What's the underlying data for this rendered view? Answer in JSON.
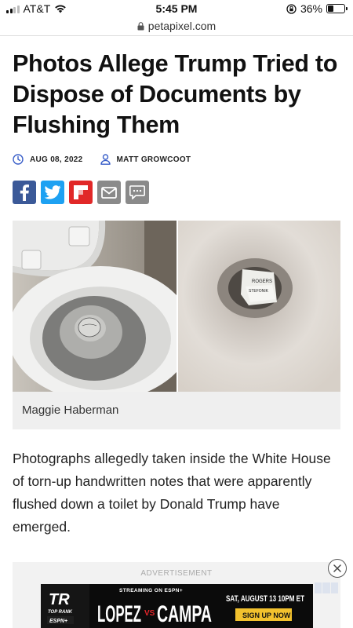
{
  "status_bar": {
    "carrier": "AT&T",
    "time": "5:45 PM",
    "battery_percent": "36%",
    "battery_level": 0.36,
    "signal_bars": 2
  },
  "browser": {
    "url": "petapixel.com"
  },
  "article": {
    "title": "Photos Allege Trump Tried to Dispose of Documents by Flushing Them",
    "date": "AUG 08, 2022",
    "author": "MATT GROWCOOT",
    "photo_caption": "Maggie Haberman",
    "photo_note_line1": "ROGERS",
    "photo_note_line2": "STEFONIK",
    "body": "Photographs allegedly taken inside the White House of torn-up handwritten notes that were apparently flushed down a toilet by Donald Trump have emerged."
  },
  "share_buttons": [
    {
      "name": "facebook",
      "icon": "facebook-icon",
      "color": "#3b5998"
    },
    {
      "name": "twitter",
      "icon": "twitter-icon",
      "color": "#1da1f2"
    },
    {
      "name": "flipboard",
      "icon": "flipboard-icon",
      "color": "#e12828"
    },
    {
      "name": "email",
      "icon": "envelope-icon",
      "color": "#8a8a8a"
    },
    {
      "name": "comment",
      "icon": "comment-icon",
      "color": "#8a8a8a"
    }
  ],
  "ad": {
    "label": "ADVERTISEMENT",
    "brand": "TR",
    "brand_sub": "TOP RANK",
    "network": "ESPN+",
    "streaming": "STREAMING ON ESPN+",
    "fighter1": "LOPEZ",
    "vs": "VS",
    "fighter2": "CAMPA",
    "date_time": "SAT, AUGUST 13 10PM ET",
    "cta": "SIGN UP NOW"
  },
  "colors": {
    "accent": "#3a5fc9",
    "text": "#111111",
    "caption_bg": "#efefef"
  }
}
